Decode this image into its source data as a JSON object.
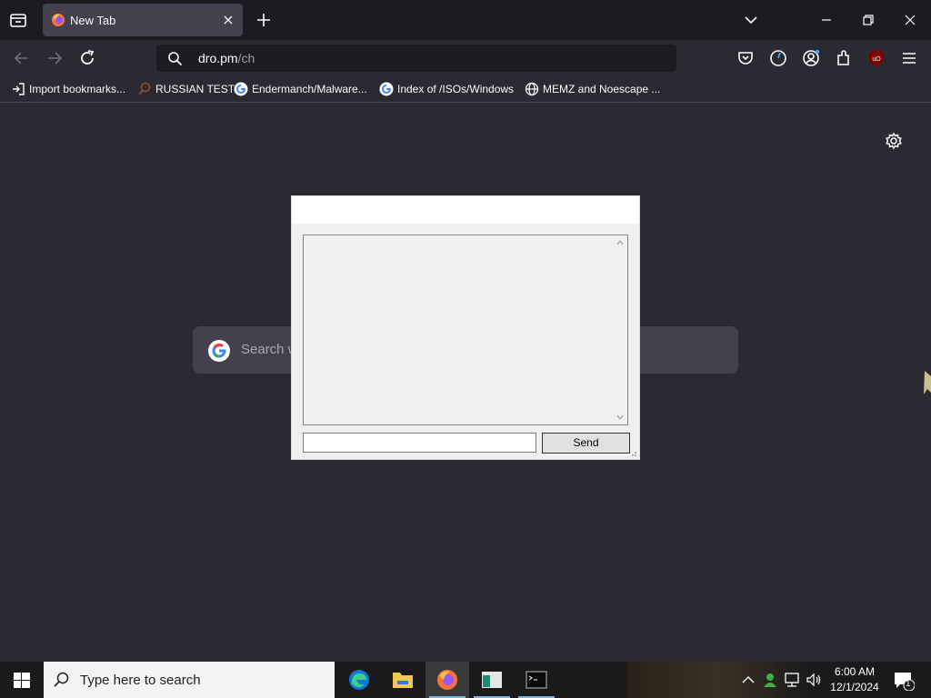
{
  "browser": {
    "tab_title": "New Tab",
    "url_domain": "dro.pm",
    "url_path": "/ch",
    "bookmarks": [
      {
        "label": "Import bookmarks...",
        "icon": "import-icon"
      },
      {
        "label": "RUSSIAN TEST",
        "icon": "magnifier-favicon"
      },
      {
        "label": "Endermanch/Malware...",
        "icon": "google-favicon"
      },
      {
        "label": "Index of /ISOs/Windows",
        "icon": "google-favicon"
      },
      {
        "label": "MEMZ and Noescape ...",
        "icon": "globe-icon"
      }
    ],
    "accent_colors": {
      "chrome": "#1c1b22",
      "toolbar": "#2b2a33",
      "tab": "#42414d"
    }
  },
  "newtab": {
    "search_placeholder": "Search w"
  },
  "dialog": {
    "send_label": "Send",
    "message_value": "",
    "log_text": ""
  },
  "taskbar": {
    "search_placeholder": "Type here to search",
    "time": "6:00 AM",
    "date": "12/1/2024",
    "notification_count": "1"
  }
}
